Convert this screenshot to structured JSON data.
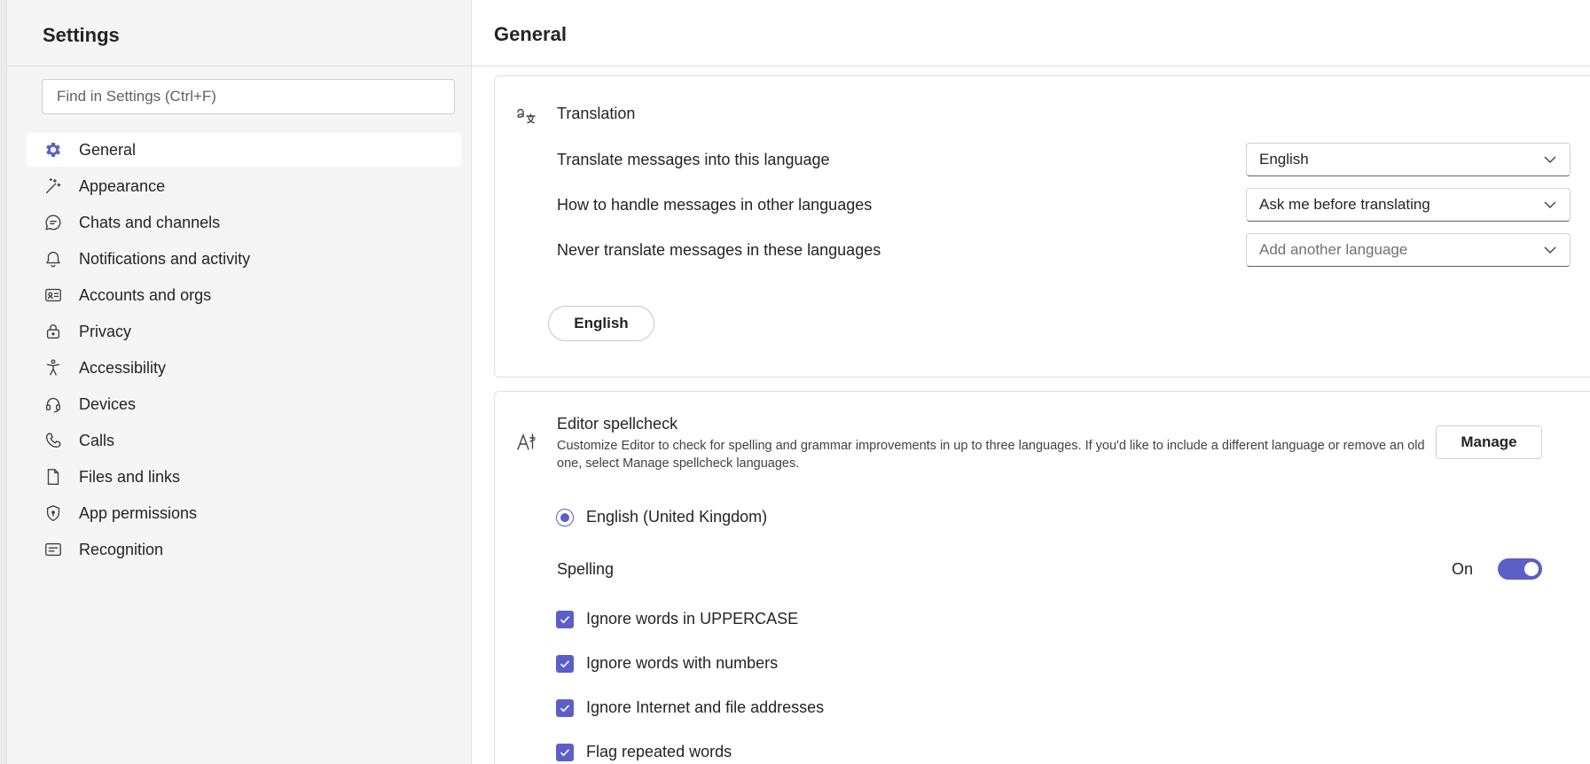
{
  "sidebar": {
    "title": "Settings",
    "search_placeholder": "Find in Settings (Ctrl+F)",
    "items": [
      {
        "label": "General",
        "icon": "gear-icon",
        "active": true
      },
      {
        "label": "Appearance",
        "icon": "magic-wand-icon",
        "active": false
      },
      {
        "label": "Chats and channels",
        "icon": "chat-icon",
        "active": false
      },
      {
        "label": "Notifications and activity",
        "icon": "bell-icon",
        "active": false
      },
      {
        "label": "Accounts and orgs",
        "icon": "contact-card-icon",
        "active": false
      },
      {
        "label": "Privacy",
        "icon": "lock-icon",
        "active": false
      },
      {
        "label": "Accessibility",
        "icon": "accessibility-icon",
        "active": false
      },
      {
        "label": "Devices",
        "icon": "headset-icon",
        "active": false
      },
      {
        "label": "Calls",
        "icon": "phone-icon",
        "active": false
      },
      {
        "label": "Files and links",
        "icon": "document-icon",
        "active": false
      },
      {
        "label": "App permissions",
        "icon": "shield-icon",
        "active": false
      },
      {
        "label": "Recognition",
        "icon": "recognition-icon",
        "active": false
      }
    ]
  },
  "main": {
    "title": "General",
    "translation": {
      "heading": "Translation",
      "icon": "translate-icon",
      "rows": [
        {
          "label": "Translate messages into this language",
          "value": "English"
        },
        {
          "label": "How to handle messages in other languages",
          "value": "Ask me before translating"
        },
        {
          "label": "Never translate messages in these languages",
          "placeholder": "Add another language"
        }
      ],
      "excluded_language": "English"
    },
    "spellcheck": {
      "heading": "Editor spellcheck",
      "icon": "spellcheck-icon",
      "description": "Customize Editor to check for spelling and grammar improvements in up to three languages. If you'd like to include a different language or remove an old one, select Manage spellcheck languages.",
      "manage_label": "Manage",
      "language": "English (United Kingdom)",
      "spelling_label": "Spelling",
      "spelling_state": "On",
      "options": [
        {
          "label": "Ignore words in UPPERCASE",
          "checked": true
        },
        {
          "label": "Ignore words with numbers",
          "checked": true
        },
        {
          "label": "Ignore Internet and file addresses",
          "checked": true
        },
        {
          "label": "Flag repeated words",
          "checked": true
        }
      ]
    }
  },
  "colors": {
    "accent": "#5b5fc7",
    "sidebar_bg": "#f5f5f5",
    "border": "#e0e0e0"
  }
}
